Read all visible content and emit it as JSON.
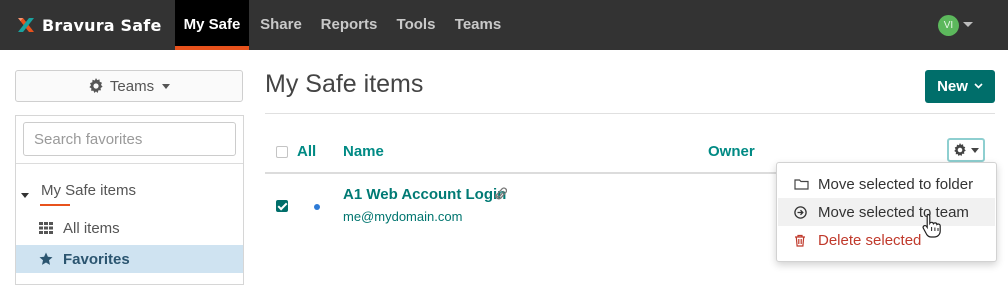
{
  "navbar": {
    "brand": "Bravura Safe",
    "items": [
      {
        "label": "My Safe",
        "active": true
      },
      {
        "label": "Share"
      },
      {
        "label": "Reports"
      },
      {
        "label": "Tools"
      },
      {
        "label": "Teams"
      }
    ],
    "avatar_initials": "VI",
    "active_color": "#e8521c"
  },
  "sidebar": {
    "teams_button": "Teams",
    "search_placeholder": "Search favorites",
    "tree_root": "My Safe items",
    "items": [
      {
        "label": "All items",
        "icon": "grid-icon"
      },
      {
        "label": "Favorites",
        "icon": "star-icon",
        "selected": true
      }
    ]
  },
  "main": {
    "title": "My Safe items",
    "new_button": "New",
    "columns": {
      "all": "All",
      "name": "Name",
      "owner": "Owner"
    },
    "rows": [
      {
        "name": "A1 Web Account Login",
        "username": "me@mydomain.com",
        "checked": true,
        "has_attachment": true
      }
    ]
  },
  "menu": {
    "items": [
      {
        "label": "Move selected to folder",
        "icon": "folder-icon"
      },
      {
        "label": "Move selected to team",
        "icon": "arrow-circle-right-icon",
        "hover": true
      },
      {
        "label": "Delete selected",
        "icon": "trash-icon",
        "danger": true
      }
    ]
  },
  "colors": {
    "brand": "#006e6a",
    "link": "#008a84",
    "danger": "#c0392b",
    "selected_bg": "#cfe3f1"
  }
}
